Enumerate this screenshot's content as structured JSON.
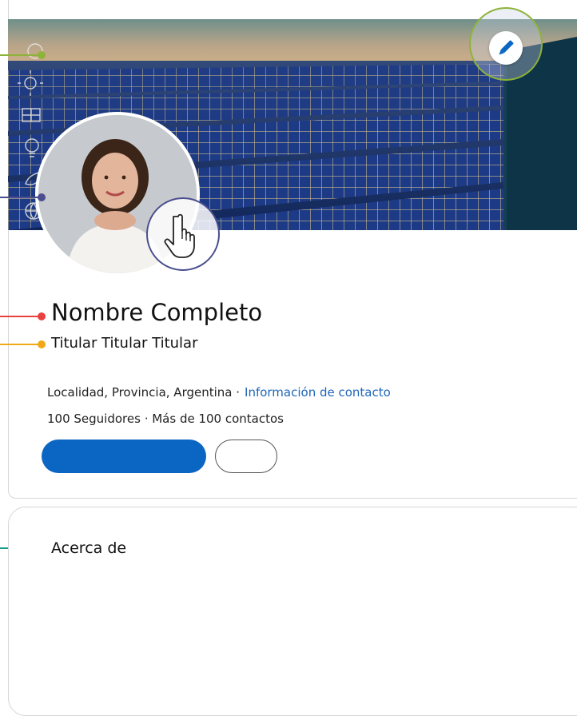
{
  "profile": {
    "full_name": "Nombre Completo",
    "headline": "Titular Titular Titular",
    "location": "Localidad, Provincia, Argentina ·",
    "contact_link": "Información de contacto",
    "followers": "100 Seguidores · Más de 100 contactos"
  },
  "sections": {
    "about_title": "Acerca de"
  },
  "icons": {
    "edit_banner": "pencil-icon",
    "avatar_cursor": "hand-pointer-icon",
    "banner_sidebar": [
      "recycle-icon",
      "sun-icon",
      "solar-panel-icon",
      "lightbulb-icon",
      "leaf-icon",
      "globe-icon"
    ]
  },
  "colors": {
    "primary_button": "#0a66c2",
    "link": "#1f66b8",
    "callout_banner": "#8db339",
    "callout_avatar": "#4a4e8e",
    "callout_name": "#e8413f",
    "callout_headline": "#f0a818",
    "callout_about": "#1a9c8c"
  }
}
